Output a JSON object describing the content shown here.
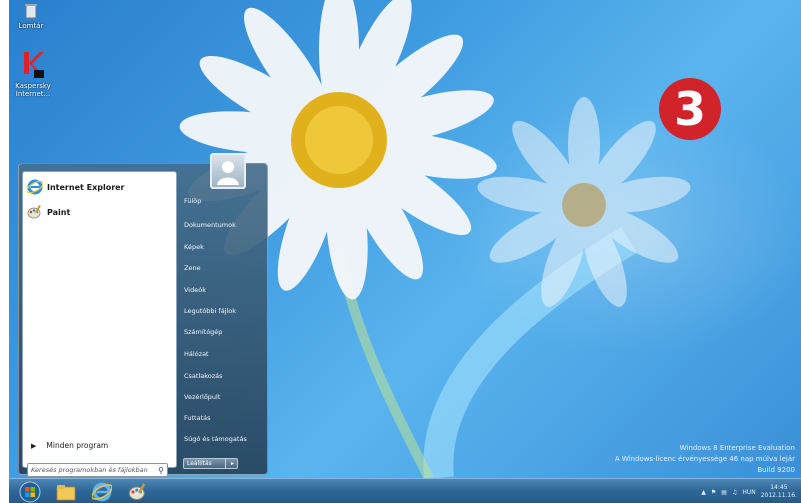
{
  "desktop": {
    "icons": [
      {
        "label": "Lomtár"
      },
      {
        "label": "Kaspersky Internet..."
      }
    ],
    "watermark": {
      "line1": "Windows 8 Enterprise Evaluation",
      "line2": "A Windows-licenc érvényessége 46 nap múlva lejár",
      "line3": "Build 9200"
    },
    "step_badge": "3"
  },
  "start_menu": {
    "pinned": [
      {
        "label": "Internet Explorer",
        "icon": "internet-explorer-icon"
      },
      {
        "label": "Paint",
        "icon": "paint-icon"
      }
    ],
    "all_programs": "Minden program",
    "search_placeholder": "Keresés programokban és fájlokban",
    "right_items": [
      "Fülöp",
      "Dokumentumok",
      "Képek",
      "Zene",
      "Videók",
      "Legutóbbi fájlok",
      "Számítógép",
      "Hálózat",
      "Csatlakozás",
      "Vezérlőpult",
      "Futtatás",
      "Súgó és támogatás"
    ],
    "shutdown_label": "Leállítás"
  },
  "taskbar": {
    "pinned_icons": [
      "start-orb-icon",
      "file-explorer-icon",
      "internet-explorer-icon",
      "paint-icon"
    ],
    "tray": {
      "language": "HUN",
      "time": "14:45",
      "date": "2012.11.16."
    }
  },
  "colors": {
    "badge": "#d0232a",
    "taskbar": "#2d6696",
    "desktop": "#3f9be0"
  }
}
